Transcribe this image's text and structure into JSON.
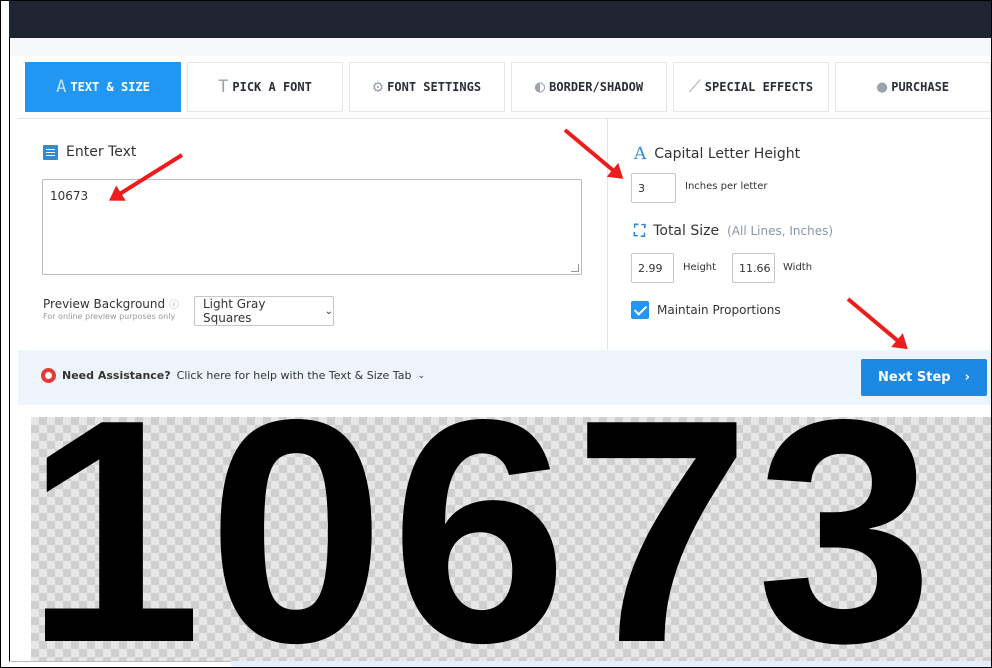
{
  "tabs": [
    {
      "label": "TEXT & SIZE",
      "icon": "text-size-icon",
      "active": true
    },
    {
      "label": "PICK A FONT",
      "icon": "font-icon",
      "active": false
    },
    {
      "label": "FONT SETTINGS",
      "icon": "gear-icon",
      "active": false
    },
    {
      "label": "BORDER/SHADOW",
      "icon": "border-icon",
      "active": false
    },
    {
      "label": "SPECIAL EFFECTS",
      "icon": "wand-icon",
      "active": false
    },
    {
      "label": "PURCHASE",
      "icon": "check-circle-icon",
      "active": false
    }
  ],
  "text_entry": {
    "label": "Enter Text",
    "value": "10673"
  },
  "preview_background": {
    "label": "Preview Background",
    "info_icon": "ⓘ",
    "sublabel": "For online preview purposes only",
    "selected": "Light Gray Squares"
  },
  "capital_height": {
    "label": "Capital Letter Height",
    "value": "3",
    "unit_label": "Inches per letter"
  },
  "total_size": {
    "label": "Total Size",
    "note": "(All Lines, Inches)",
    "height_value": "2.99",
    "height_label": "Height",
    "width_value": "11.66",
    "width_label": "Width"
  },
  "maintain_proportions": {
    "label": "Maintain Proportions",
    "checked": true
  },
  "assistance": {
    "bold": "Need Assistance?",
    "text": "Click here for help with the Text & Size Tab"
  },
  "next_button": {
    "label": "Next Step",
    "icon": "chevron-right-icon"
  },
  "preview_text": "10673",
  "colors": {
    "accent": "#2196f3",
    "header": "#1f2432",
    "annotation": "#ee1c1c"
  }
}
